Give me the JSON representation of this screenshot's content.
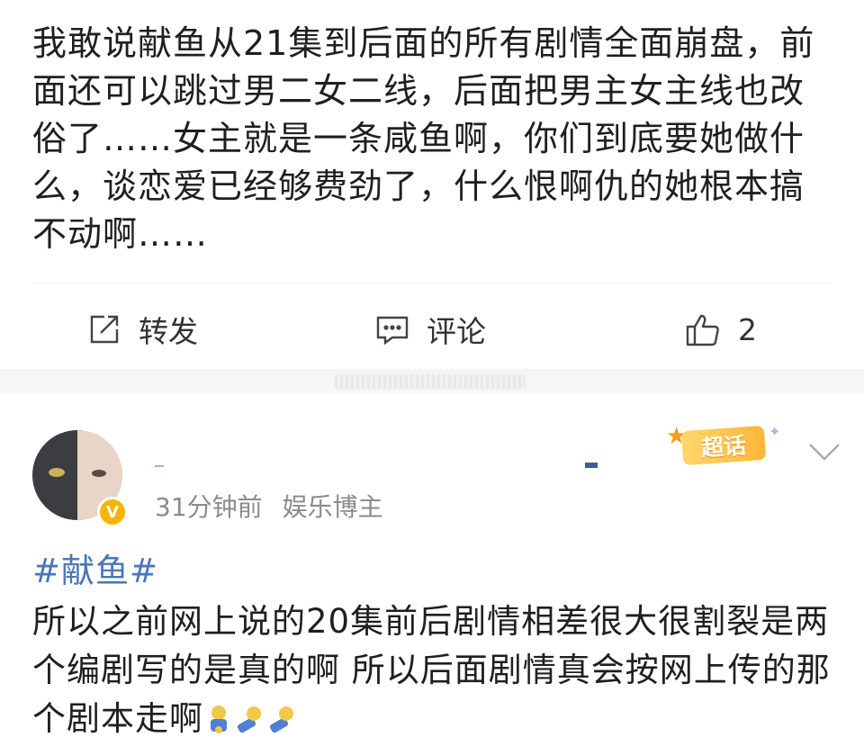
{
  "post1": {
    "text": "我敢说献鱼从21集到后面的所有剧情全面崩盘，前面还可以跳过男二女二线，后面把男主女主线也改俗了……女主就是一条咸鱼啊，你们到底要她做什么，谈恋爱已经够费劲了，什么恨啊仇的她根本搞不动啊……",
    "actions": {
      "repost_label": "转发",
      "comment_label": "评论",
      "like_count": "2"
    }
  },
  "post2": {
    "verified_badge": "V",
    "time": "31分钟前",
    "user_tag": "娱乐博主",
    "super_topic_label": "超话",
    "hashtag": "#献鱼#",
    "text": "所以之前网上说的20集前后剧情相差很大很割裂是两个编剧写的是真的啊 所以后面剧情真会按网上传的那个剧本走啊"
  },
  "icons": [
    "repost-icon",
    "comment-icon",
    "thumbs-up-icon",
    "chevron-down-icon",
    "verified-badge-icon",
    "super-topic-icon"
  ],
  "colors": {
    "link": "#4a76b8",
    "meta": "#8b8b8b",
    "badge": "#f5b400"
  }
}
